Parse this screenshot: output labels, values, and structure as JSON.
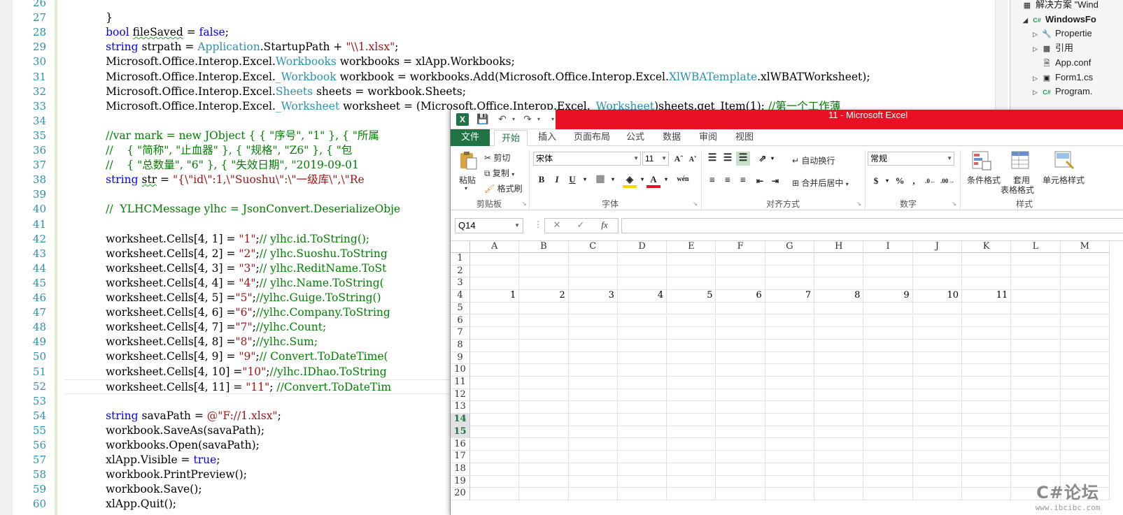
{
  "editor": {
    "line_numbers": [
      "26",
      "27",
      "28",
      "29",
      "30",
      "31",
      "32",
      "33",
      "34",
      "35",
      "36",
      "37",
      "38",
      "39",
      "40",
      "41",
      "42",
      "43",
      "44",
      "45",
      "46",
      "47",
      "48",
      "49",
      "50",
      "51",
      "52",
      "53",
      "54",
      "55",
      "56",
      "57",
      "58",
      "59",
      "60"
    ],
    "lines": [
      [],
      [
        {
          "t": "            }"
        }
      ],
      [
        {
          "t": "            "
        },
        {
          "t": "bool",
          "c": "kw"
        },
        {
          "t": " "
        },
        {
          "t": "fileSaved",
          "c": "sq"
        },
        {
          "t": " = "
        },
        {
          "t": "false",
          "c": "kw"
        },
        {
          "t": ";"
        }
      ],
      [
        {
          "t": "            "
        },
        {
          "t": "string",
          "c": "kw"
        },
        {
          "t": " strpath = "
        },
        {
          "t": "Application",
          "c": "ty"
        },
        {
          "t": ".StartupPath + "
        },
        {
          "t": "\"\\\\1.xlsx\"",
          "c": "st"
        },
        {
          "t": ";"
        }
      ],
      [
        {
          "t": "            Microsoft.Office.Interop.Excel."
        },
        {
          "t": "Workbooks",
          "c": "ty"
        },
        {
          "t": " workbooks = xlApp.Workbooks;"
        }
      ],
      [
        {
          "t": "            Microsoft.Office.Interop.Excel."
        },
        {
          "t": "_Workbook",
          "c": "ty"
        },
        {
          "t": " workbook = workbooks.Add(Microsoft.Office.Interop.Excel."
        },
        {
          "t": "XlWBATemplate",
          "c": "ty"
        },
        {
          "t": ".xlWBATWorksheet);"
        }
      ],
      [
        {
          "t": "            Microsoft.Office.Interop.Excel."
        },
        {
          "t": "Sheets",
          "c": "ty"
        },
        {
          "t": " sheets = workbook.Sheets;"
        }
      ],
      [
        {
          "t": "            Microsoft.Office.Interop.Excel."
        },
        {
          "t": "_Worksheet",
          "c": "ty"
        },
        {
          "t": " worksheet = (Microsoft.Office.Interop.Excel."
        },
        {
          "t": "_Worksheet",
          "c": "ty"
        },
        {
          "t": ")sheets.get_Item(1); "
        },
        {
          "t": "//第一个工作薄",
          "c": "cm"
        }
      ],
      [],
      [
        {
          "t": "            "
        },
        {
          "t": "//var mark = new JObject { { \"序号\", \"1\" }, { \"所属",
          "c": "cm"
        }
      ],
      [
        {
          "t": "            "
        },
        {
          "t": "//    { \"简称\", \"止血器\" }, { \"规格\", \"Z6\" }, { \"包",
          "c": "cm"
        }
      ],
      [
        {
          "t": "            "
        },
        {
          "t": "//    { \"总数量\", \"6\" }, { \"失效日期\", \"2019-09-01",
          "c": "cm"
        }
      ],
      [
        {
          "t": "            "
        },
        {
          "t": "string",
          "c": "kw"
        },
        {
          "t": " "
        },
        {
          "t": "str",
          "c": "sq"
        },
        {
          "t": " = "
        },
        {
          "t": "\"{\\\"id\\\":1,\\\"Suoshu\\\":\\\"一级库\\\",\\\"Re",
          "c": "st"
        }
      ],
      [],
      [
        {
          "t": "            "
        },
        {
          "t": "//  YLHCMessage ylhc = JsonConvert.DeserializeObje",
          "c": "cm"
        }
      ],
      [],
      [
        {
          "t": "            worksheet.Cells[4, 1] = "
        },
        {
          "t": "\"1\"",
          "c": "st"
        },
        {
          "t": ";"
        },
        {
          "t": "// ylhc.id.ToString();",
          "c": "cm"
        }
      ],
      [
        {
          "t": "            worksheet.Cells[4, 2] = "
        },
        {
          "t": "\"2\"",
          "c": "st"
        },
        {
          "t": ";"
        },
        {
          "t": "// ylhc.Suoshu.ToString",
          "c": "cm"
        }
      ],
      [
        {
          "t": "            worksheet.Cells[4, 3] = "
        },
        {
          "t": "\"3\"",
          "c": "st"
        },
        {
          "t": ";"
        },
        {
          "t": "// ylhc.ReditName.ToSt",
          "c": "cm"
        }
      ],
      [
        {
          "t": "            worksheet.Cells[4, 4] = "
        },
        {
          "t": "\"4\"",
          "c": "st"
        },
        {
          "t": ";"
        },
        {
          "t": "// ylhc.Name.ToString(",
          "c": "cm"
        }
      ],
      [
        {
          "t": "            worksheet.Cells[4, 5] ="
        },
        {
          "t": "\"5\"",
          "c": "st"
        },
        {
          "t": ";"
        },
        {
          "t": "//ylhc.Guige.ToString()",
          "c": "cm"
        }
      ],
      [
        {
          "t": "            worksheet.Cells[4, 6] ="
        },
        {
          "t": "\"6\"",
          "c": "st"
        },
        {
          "t": ";"
        },
        {
          "t": "//ylhc.Company.ToString",
          "c": "cm"
        }
      ],
      [
        {
          "t": "            worksheet.Cells[4, 7] ="
        },
        {
          "t": "\"7\"",
          "c": "st"
        },
        {
          "t": ";"
        },
        {
          "t": "//ylhc.Count;",
          "c": "cm"
        }
      ],
      [
        {
          "t": "            worksheet.Cells[4, 8] ="
        },
        {
          "t": "\"8\"",
          "c": "st"
        },
        {
          "t": ";"
        },
        {
          "t": "//ylhc.Sum;",
          "c": "cm"
        }
      ],
      [
        {
          "t": "            worksheet.Cells[4, 9] = "
        },
        {
          "t": "\"9\"",
          "c": "st"
        },
        {
          "t": ";"
        },
        {
          "t": "// Convert.ToDateTime(",
          "c": "cm"
        }
      ],
      [
        {
          "t": "            worksheet.Cells[4, 10] ="
        },
        {
          "t": "\"10\"",
          "c": "st"
        },
        {
          "t": ";"
        },
        {
          "t": "//ylhc.IDhao.ToString",
          "c": "cm"
        }
      ],
      [
        {
          "t": "            worksheet.Cells[4, 11] = "
        },
        {
          "t": "\"11\"",
          "c": "st"
        },
        {
          "t": "; "
        },
        {
          "t": "//Convert.ToDateTim",
          "c": "cm"
        }
      ],
      [],
      [
        {
          "t": "            "
        },
        {
          "t": "string",
          "c": "kw"
        },
        {
          "t": " savaPath = "
        },
        {
          "t": "@\"F://1.xlsx\"",
          "c": "st"
        },
        {
          "t": ";"
        }
      ],
      [
        {
          "t": "            workbook.SaveAs(savaPath);"
        }
      ],
      [
        {
          "t": "            workbooks.Open(savaPath);"
        }
      ],
      [
        {
          "t": "            xlApp.Visible = "
        },
        {
          "t": "true",
          "c": "kw"
        },
        {
          "t": ";"
        }
      ],
      [
        {
          "t": "            workbook.PrintPreview();"
        }
      ],
      [
        {
          "t": "            workbook.Save();"
        }
      ],
      [
        {
          "t": "            xlApp.Quit();"
        }
      ]
    ]
  },
  "solution": {
    "items": [
      {
        "label": "解决方案 \"Wind",
        "icon": "solution-icon",
        "indent": 0,
        "arrow": ""
      },
      {
        "label": "WindowsFo",
        "icon": "csharp-project-icon",
        "indent": 1,
        "arrow": "◢",
        "bold": true
      },
      {
        "label": "Propertie",
        "icon": "wrench-icon",
        "indent": 2,
        "arrow": "▷"
      },
      {
        "label": "引用",
        "icon": "references-icon",
        "indent": 2,
        "arrow": "▷"
      },
      {
        "label": "App.conf",
        "icon": "config-file-icon",
        "indent": 2,
        "arrow": ""
      },
      {
        "label": "Form1.cs",
        "icon": "form-icon",
        "indent": 2,
        "arrow": "▷"
      },
      {
        "label": "Program.",
        "icon": "csharp-file-icon",
        "indent": 2,
        "arrow": "▷"
      }
    ]
  },
  "excel": {
    "title": "11 -  Microsoft Excel",
    "tabs": [
      "文件",
      "开始",
      "插入",
      "页面布局",
      "公式",
      "数据",
      "审阅",
      "视图"
    ],
    "active_tab": "开始",
    "clipboard": {
      "paste": "粘贴",
      "cut": "剪切",
      "copy": "复制",
      "format_painter": "格式刷",
      "group": "剪贴板"
    },
    "font": {
      "name": "宋体",
      "size": "11",
      "group": "字体",
      "bold": "B",
      "italic": "I",
      "underline": "U"
    },
    "alignment": {
      "wrap": "自动换行",
      "merge": "合并后居中",
      "group": "对齐方式"
    },
    "number": {
      "format": "常规",
      "group": "数字",
      "currency": "$",
      "percent": "%",
      "comma": ","
    },
    "styles": {
      "conditional": "条件格式",
      "table1": "套用",
      "table2": "表格格式",
      "cell": "单元格样式",
      "group": "样式"
    },
    "namebox": "Q14",
    "fx": "fx",
    "columns": [
      "A",
      "B",
      "C",
      "D",
      "E",
      "F",
      "G",
      "H",
      "I",
      "J",
      "K",
      "L",
      "M"
    ],
    "rows": [
      "1",
      "2",
      "3",
      "4",
      "5",
      "6",
      "7",
      "8",
      "9",
      "10",
      "11",
      "12",
      "13",
      "14",
      "15",
      "16",
      "17",
      "18",
      "19",
      "20"
    ],
    "highlighted_rows": [
      "14",
      "15"
    ],
    "row4_values": [
      "1",
      "2",
      "3",
      "4",
      "5",
      "6",
      "7",
      "8",
      "9",
      "10",
      "11"
    ]
  },
  "watermark": {
    "main": "C#论坛",
    "sub": "www.ibcibc.com"
  },
  "colors": {
    "excel_green": "#217346",
    "title_red": "#e81123",
    "keyword": "#0000ff",
    "type": "#2b91af",
    "string": "#a31515",
    "comment": "#008000"
  }
}
